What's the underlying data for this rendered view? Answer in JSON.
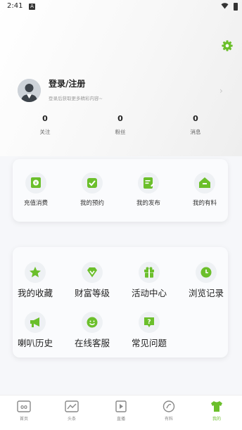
{
  "status_bar": {
    "time": "2:41",
    "a_badge": "A"
  },
  "profile": {
    "login_title": "登录/注册",
    "login_subtitle": "登录后获取更多精彩内容~"
  },
  "stats": [
    {
      "value": "0",
      "label": "关注"
    },
    {
      "value": "0",
      "label": "粉丝"
    },
    {
      "value": "0",
      "label": "消息"
    }
  ],
  "quick_actions": [
    {
      "label": "充值消费",
      "icon": "wallet-icon"
    },
    {
      "label": "我的预约",
      "icon": "check-icon"
    },
    {
      "label": "我的发布",
      "icon": "edit-document-icon"
    },
    {
      "label": "我的有料",
      "icon": "house-icon"
    }
  ],
  "features": [
    {
      "label": "我的收藏",
      "icon": "star-icon"
    },
    {
      "label": "财富等级",
      "icon": "diamond-icon"
    },
    {
      "label": "活动中心",
      "icon": "gift-icon"
    },
    {
      "label": "浏览记录",
      "icon": "clock-icon"
    },
    {
      "label": "喇叭历史",
      "icon": "megaphone-icon"
    },
    {
      "label": "在线客服",
      "icon": "smiley-icon"
    },
    {
      "label": "常见问题",
      "icon": "question-icon"
    }
  ],
  "tabs": [
    {
      "label": "首页",
      "icon": "home-icon"
    },
    {
      "label": "头条",
      "icon": "news-icon"
    },
    {
      "label": "直播",
      "icon": "play-icon"
    },
    {
      "label": "有料",
      "icon": "material-icon"
    },
    {
      "label": "我的",
      "icon": "shirt-icon"
    }
  ],
  "colors": {
    "accent": "#6bbf2b",
    "icon_bg": "#eef1f4"
  }
}
